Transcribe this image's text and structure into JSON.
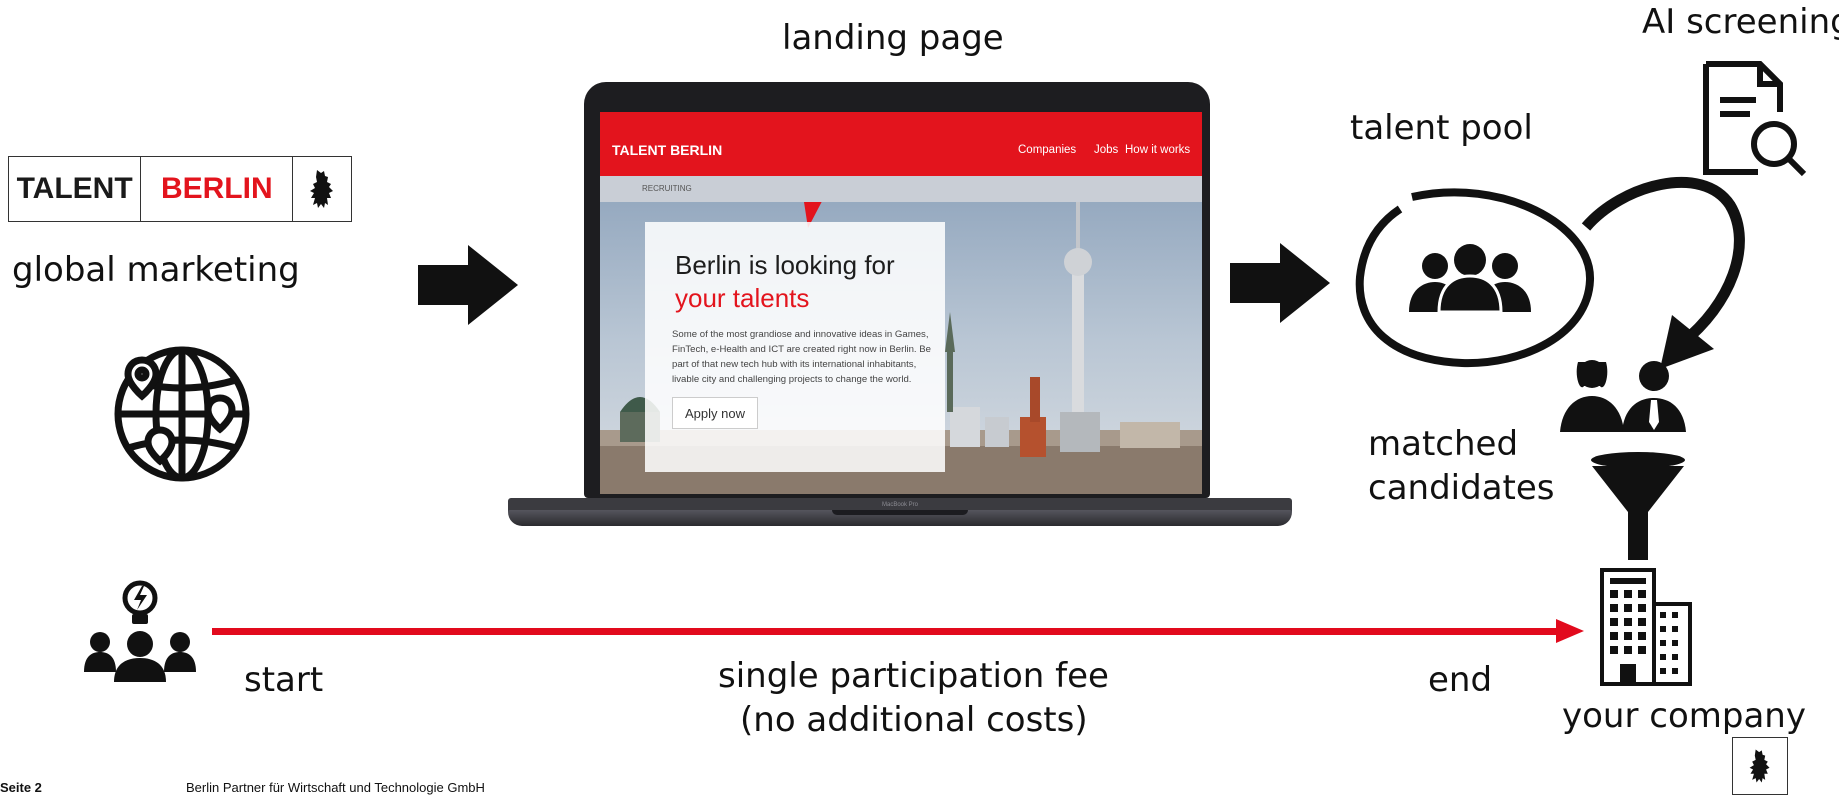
{
  "logo": {
    "talent": "TALENT",
    "berlin": "BERLIN"
  },
  "labels": {
    "global_marketing": "global marketing",
    "landing_page": "landing page",
    "talent_pool": "talent pool",
    "ai_screening": "AI screening",
    "matched_line1": "matched",
    "matched_line2": "candidates",
    "start": "start",
    "fee_line1": "single participation fee",
    "fee_line2": "(no additional costs)",
    "end": "end",
    "your_company": "your company"
  },
  "footer": {
    "page": "Seite 2",
    "company": "Berlin Partner für Wirtschaft und Technologie GmbH"
  },
  "screen": {
    "logo": "TALENT BERLIN",
    "nav": [
      "Companies",
      "Jobs",
      "How it works"
    ],
    "subnav": "RECRUITING",
    "title_line1": "Berlin is looking for",
    "title_line2": "your talents",
    "body": "Some of the most grandiose and innovative ideas in Games, FinTech, e-Health and ICT are created right now in Berlin. Be part of that new tech hub with its international inhabitants, livable city and challenging projects to change the world.",
    "button": "Apply now",
    "device_brand": "MacBook Pro"
  },
  "colors": {
    "brand_red": "#e3141d",
    "timeline_red": "#e20a1d",
    "dark": "#111111"
  },
  "icons": [
    "bear-icon",
    "globe-icon",
    "ideas-team-icon",
    "users-group-icon",
    "screening-document-icon",
    "candidates-icon",
    "funnel-icon",
    "building-icon"
  ]
}
